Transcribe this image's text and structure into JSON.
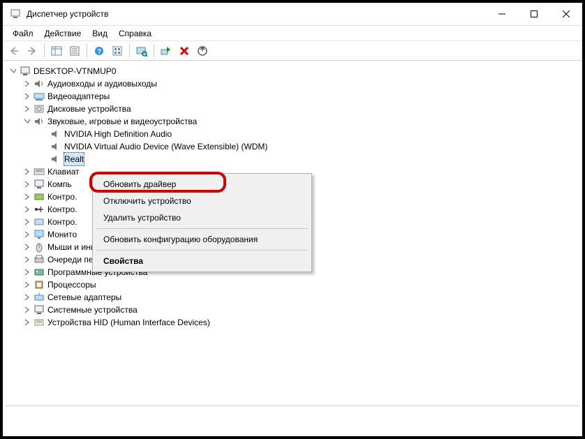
{
  "window": {
    "title": "Диспетчер устройств"
  },
  "menu": {
    "file": "Файл",
    "action": "Действие",
    "view": "Вид",
    "help": "Справка"
  },
  "tree": {
    "root": "DESKTOP-VTNMUP0",
    "audio_io": "Аудиовходы и аудиовыходы",
    "video": "Видеоадаптеры",
    "disk": "Дисковые устройства",
    "sound": "Звуковые, игровые и видеоустройства",
    "sound_children": {
      "nvidia_hd": "NVIDIA High Definition Audio",
      "nvidia_virtual": "NVIDIA Virtual Audio Device (Wave Extensible) (WDM)",
      "realtek": "Realt"
    },
    "keyboard": "Клавиат",
    "computer": "Компь",
    "controllers_ide": "Контро.",
    "controllers_usb": "Контро.",
    "mice_alt": "Контро.",
    "monitors": "Монито",
    "mice": "Мыши и иные указывающие устройства",
    "print": "Очереди печати",
    "software": "Программные устройства",
    "cpu": "Процессоры",
    "net": "Сетевые адаптеры",
    "system": "Системные устройства",
    "hid": "Устройства HID (Human Interface Devices)"
  },
  "context_menu": {
    "update": "Обновить драйвер",
    "disable": "Отключить устройство",
    "uninstall": "Удалить устройство",
    "scan": "Обновить конфигурацию оборудования",
    "properties": "Свойства"
  }
}
